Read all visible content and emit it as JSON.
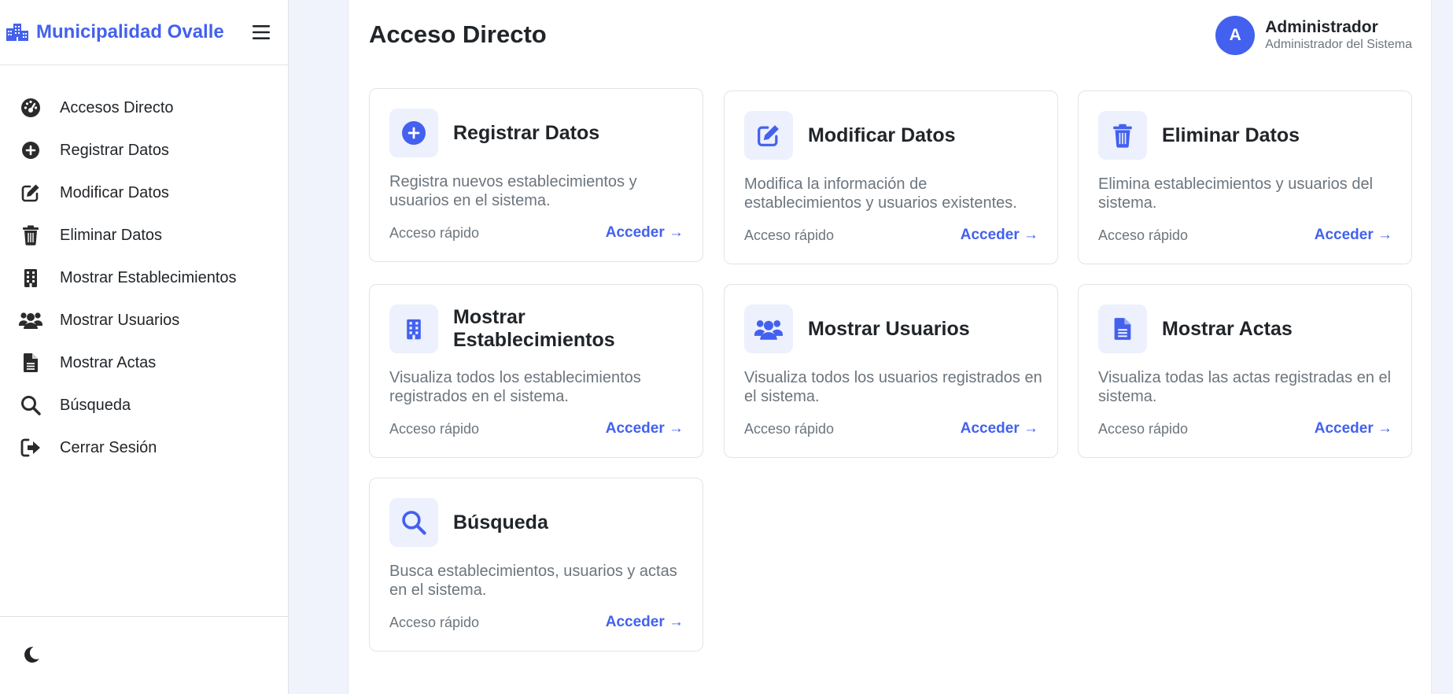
{
  "colors": {
    "accent": "#4361ee",
    "icon_bg": "#edf0fd",
    "sidebar_icon": "#2b2b2b"
  },
  "brand": {
    "title": "Municipalidad Ovalle",
    "icon": "building-icon"
  },
  "sidebar": {
    "items": [
      {
        "label": "Accesos Directo",
        "icon": "dashboard-icon"
      },
      {
        "label": "Registrar Datos",
        "icon": "plus-circle-icon"
      },
      {
        "label": "Modificar Datos",
        "icon": "edit-icon"
      },
      {
        "label": "Eliminar Datos",
        "icon": "trash-icon"
      },
      {
        "label": "Mostrar Establecimientos",
        "icon": "building-icon"
      },
      {
        "label": "Mostrar Usuarios",
        "icon": "users-icon"
      },
      {
        "label": "Mostrar Actas",
        "icon": "file-icon"
      },
      {
        "label": "Búsqueda",
        "icon": "search-icon"
      },
      {
        "label": "Cerrar Sesión",
        "icon": "logout-icon"
      }
    ],
    "theme_toggle_icon": "moon-icon"
  },
  "header": {
    "title": "Acceso Directo",
    "user": {
      "initial": "A",
      "name": "Administrador",
      "role": "Administrador del Sistema"
    }
  },
  "cards": [
    {
      "title": "Registrar Datos",
      "desc": "Registra nuevos establecimientos y usuarios en el sistema.",
      "meta": "Acceso rápido",
      "link": "Acceder →",
      "icon": "plus-circle-icon"
    },
    {
      "title": "Modificar Datos",
      "desc": "Modifica la información de establecimientos y usuarios existentes.",
      "meta": "Acceso rápido",
      "link": "Acceder →",
      "icon": "edit-icon"
    },
    {
      "title": "Eliminar Datos",
      "desc": "Elimina establecimientos y usuarios del sistema.",
      "meta": "Acceso rápido",
      "link": "Acceder →",
      "icon": "trash-icon"
    },
    {
      "title": "Mostrar Establecimientos",
      "desc": "Visualiza todos los establecimientos registrados en el sistema.",
      "meta": "Acceso rápido",
      "link": "Acceder →",
      "icon": "building-icon"
    },
    {
      "title": "Mostrar Usuarios",
      "desc": "Visualiza todos los usuarios registrados en el sistema.",
      "meta": "Acceso rápido",
      "link": "Acceder →",
      "icon": "users-icon"
    },
    {
      "title": "Mostrar Actas",
      "desc": "Visualiza todas las actas registradas en el sistema.",
      "meta": "Acceso rápido",
      "link": "Acceder →",
      "icon": "file-icon"
    },
    {
      "title": "Búsqueda",
      "desc": "Busca establecimientos, usuarios y actas en el sistema.",
      "meta": "Acceso rápido",
      "link": "Acceder →",
      "icon": "search-icon"
    }
  ]
}
